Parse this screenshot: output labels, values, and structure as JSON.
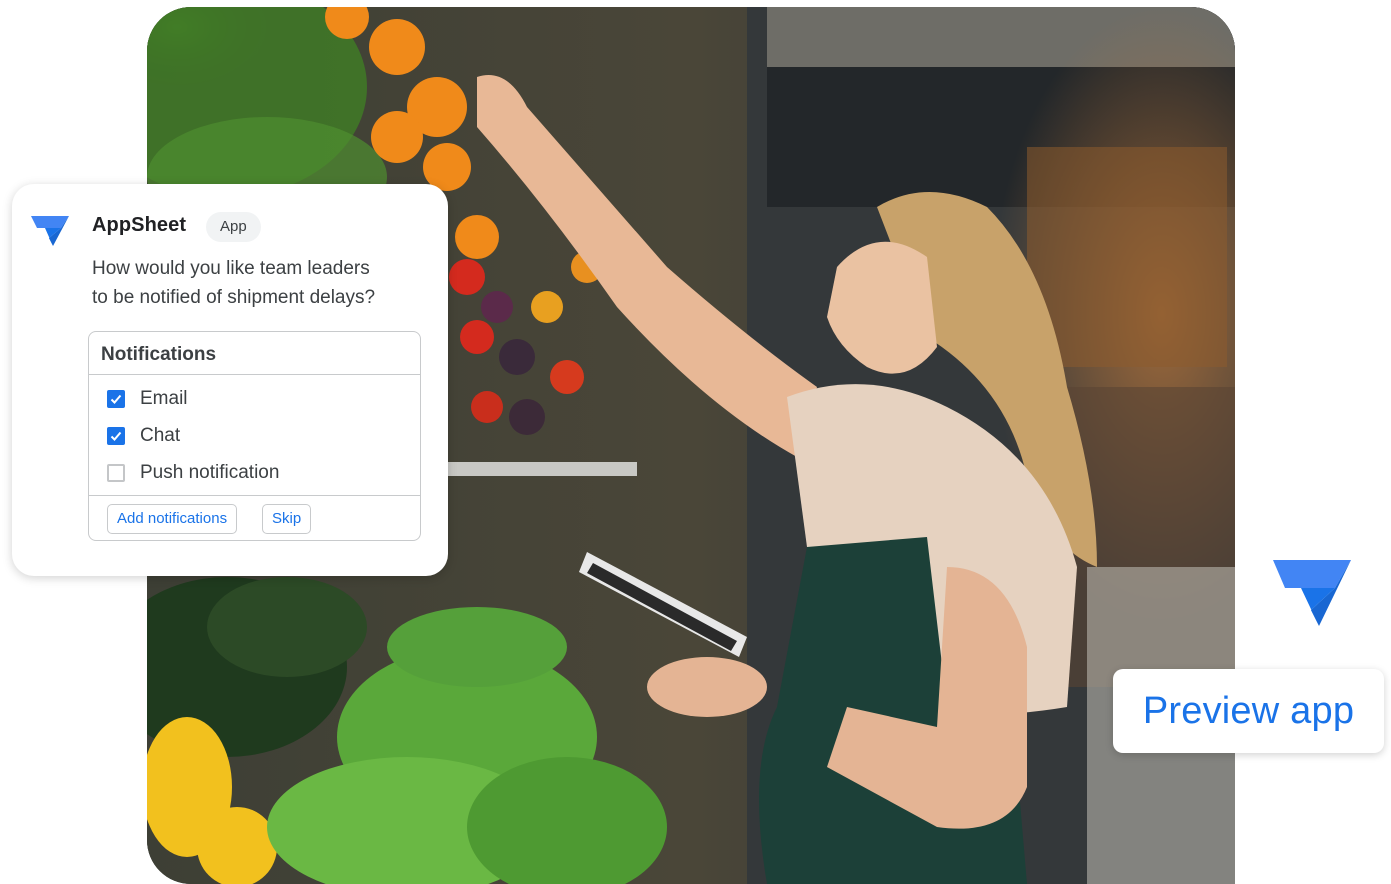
{
  "chat_card": {
    "app_name": "AppSheet",
    "badge": "App",
    "question_line1": "How would you like team leaders",
    "question_line2": "to be notified of shipment delays?",
    "notifications": {
      "title": "Notifications",
      "options": [
        {
          "label": "Email",
          "checked": true
        },
        {
          "label": "Chat",
          "checked": true
        },
        {
          "label": "Push notification",
          "checked": false
        }
      ],
      "add_button": "Add notifications",
      "skip_button": "Skip"
    }
  },
  "preview": {
    "label": "Preview app"
  },
  "colors": {
    "accent": "#1a73e8",
    "logo_light": "#4285f4",
    "logo_dark": "#1967d2"
  },
  "icons": {
    "card_logo": "appsheet-logo-icon",
    "big_logo": "appsheet-logo-icon",
    "checkmark": "check-icon"
  }
}
